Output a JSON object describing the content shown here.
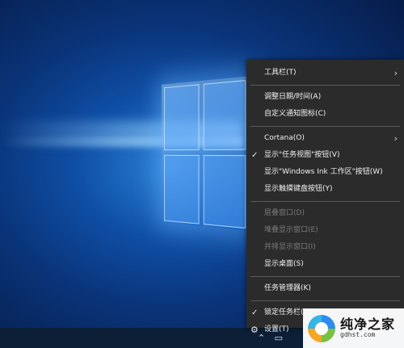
{
  "taskbar_context_menu": {
    "items": [
      {
        "label": "工具栏(T)",
        "submenu": true
      },
      {
        "separator": true
      },
      {
        "label": "调整日期/时间(A)"
      },
      {
        "label": "自定义通知图标(C)"
      },
      {
        "separator": true
      },
      {
        "label": "Cortana(O)",
        "submenu": true
      },
      {
        "label": "显示\"任务视图\"按钮(V)",
        "checked": true
      },
      {
        "label": "显示\"Windows Ink 工作区\"按钮(W)"
      },
      {
        "label": "显示触摸键盘按钮(Y)"
      },
      {
        "separator": true
      },
      {
        "label": "层叠窗口(D)",
        "disabled": true
      },
      {
        "label": "堆叠显示窗口(E)",
        "disabled": true
      },
      {
        "label": "并排显示窗口(I)",
        "disabled": true
      },
      {
        "label": "显示桌面(S)"
      },
      {
        "separator": true
      },
      {
        "label": "任务管理器(K)"
      },
      {
        "separator": true
      },
      {
        "label": "锁定任务栏(L)",
        "checked": true
      },
      {
        "label": "设置(T)",
        "icon": "gear-icon"
      }
    ]
  },
  "watermark": {
    "title": "纯净之家",
    "url": "gdhst.com"
  },
  "colors": {
    "menu_bg": "#2b2b2b",
    "menu_text": "#f2f2f2",
    "disabled_text": "#7a7a7a",
    "taskbar_bg": "#0c1f36"
  }
}
